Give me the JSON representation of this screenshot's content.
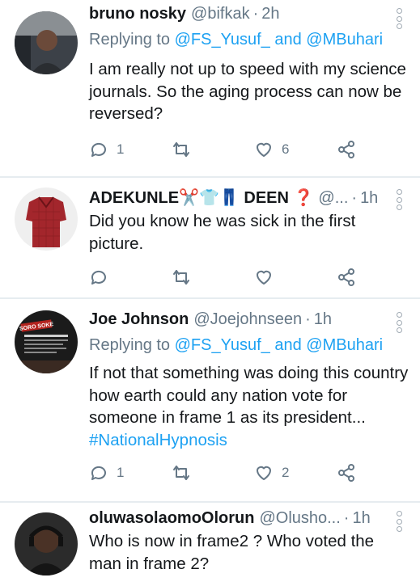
{
  "tweets": [
    {
      "name": "bruno nosky",
      "handle": "@bifkak",
      "dot": "·",
      "time": "2h",
      "replying_prefix": "Replying to",
      "replying_user1": "@FS_Yusuf_",
      "replying_and": "and",
      "replying_user2": "@MBuhari",
      "body": "I am really not up to speed with my science journals. So the aging process can now be reversed?",
      "replies": "1",
      "retweets": "",
      "likes": "6"
    },
    {
      "name": "ADEKUNLE✂️👕👖 DEEN ❓",
      "handle": "@...",
      "dot": "·",
      "time": "1h",
      "body": "Did you know he was sick in the first picture.",
      "replies": "",
      "retweets": "",
      "likes": ""
    },
    {
      "name": "Joe Johnson",
      "handle": "@Joejohnseen",
      "dot": "·",
      "time": "1h",
      "replying_prefix": "Replying to",
      "replying_user1": "@FS_Yusuf_",
      "replying_and": "and",
      "replying_user2": "@MBuhari",
      "body_text": "If not that something was doing this country how earth could any nation vote for someone in frame 1 as its president...",
      "hashtag": "#NationalHypnosis",
      "avatar_caption": "SORO SOKE",
      "replies": "1",
      "retweets": "",
      "likes": "2"
    },
    {
      "name": "oluwasolaomoOlorun",
      "handle": "@Olusho...",
      "dot": "·",
      "time": "1h",
      "body": "Who is now in frame2 ? Who voted the man in frame 2?"
    }
  ],
  "colors": {
    "link": "#1da1f2",
    "muted": "#657786",
    "text": "#14171a",
    "divider": "#e6ecf0"
  },
  "icons": [
    "reply-icon",
    "retweet-icon",
    "like-icon",
    "share-icon",
    "more-options-icon"
  ]
}
